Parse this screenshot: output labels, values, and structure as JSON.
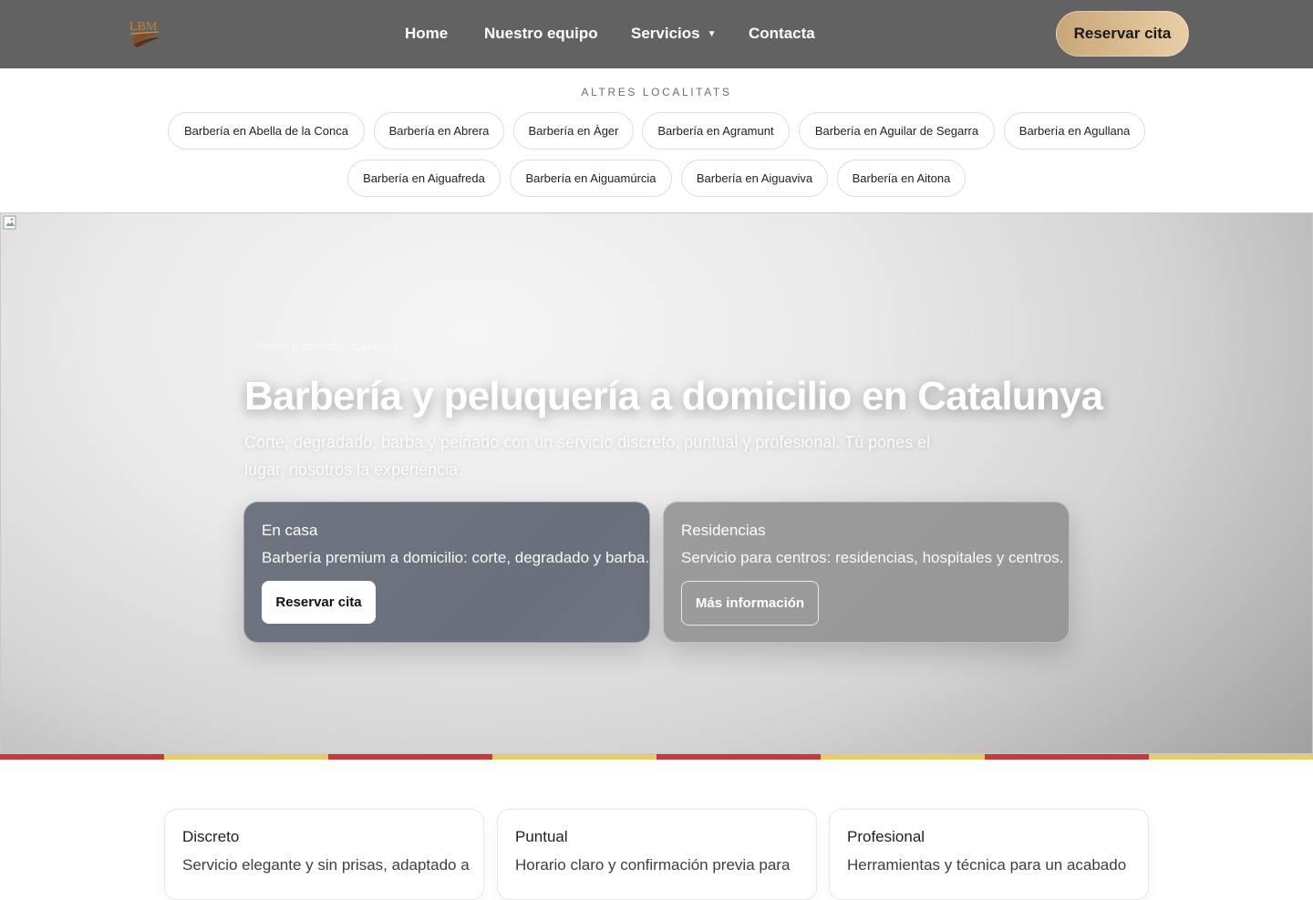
{
  "header": {
    "logo_text": "LBM",
    "nav": [
      {
        "label": "Home"
      },
      {
        "label": "Nuestro equipo"
      },
      {
        "label": "Servicios",
        "has_dropdown": true
      },
      {
        "label": "Contacta"
      }
    ],
    "cta_label": "Reservar cita",
    "colors": {
      "bar": "#626262",
      "cta_from": "#c9a677",
      "cta_to": "#e9cfa6"
    }
  },
  "localities": {
    "title": "ALTRES LOCALITATS",
    "chips": [
      "Barbería en Abella de la Conca",
      "Barbería en Abrera",
      "Barbería en Àger",
      "Barbería en Agramunt",
      "Barbería en Aguilar de Segarra",
      "Barbería en Agullana",
      "Barbería en Aiguafreda",
      "Barbería en Aiguamúrcia",
      "Barbería en Aiguaviva",
      "Barbería en Aitona"
    ]
  },
  "hero": {
    "kicker": "Servei a domicili · Catalunya",
    "title": "Barbería y peluquería a domicilio en Catalunya",
    "subtitle": "Corte, degradado, barba y peinado con un servicio discreto, puntual y profesional. Tú pones el lugar, nosotros la experiencia.",
    "cards": [
      {
        "title": "En casa",
        "text": "Barbería premium a domicilio: corte, degradado y barba.",
        "button": "Reservar cita"
      },
      {
        "title": "Residencias",
        "text": "Servicio para centros: residencias, hospitales y centros.",
        "button": "Más información"
      }
    ]
  },
  "stripe_colors": [
    "#c8393e",
    "#eacb67",
    "#c8393e",
    "#eacb67",
    "#c8393e",
    "#eacb67",
    "#c8393e",
    "#eacb67"
  ],
  "features": [
    {
      "title": "Discreto",
      "text": "Servicio elegante y sin prisas, adaptado a"
    },
    {
      "title": "Puntual",
      "text": "Horario claro y confirmación previa para"
    },
    {
      "title": "Profesional",
      "text": "Herramientas y técnica para un acabado"
    }
  ]
}
